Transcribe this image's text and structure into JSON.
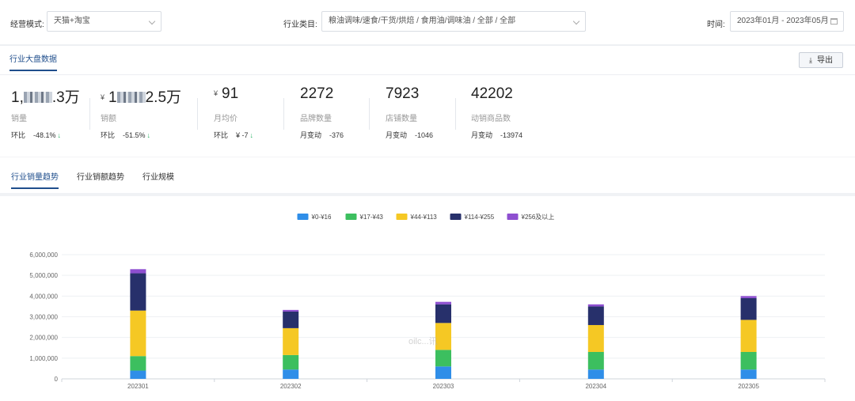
{
  "filters": {
    "mode_label": "经营模式:",
    "mode_value": "天猫+淘宝",
    "industry_label": "行业类目:",
    "industry_value": "粮油调味/速食/干货/烘焙 / 食用油/调味油 / 全部 / 全部",
    "time_label": "时间:",
    "time_value": "2023年01月 - 2023年05月"
  },
  "section": {
    "tab": "行业大盘数据",
    "export_label": "导出"
  },
  "metrics": [
    {
      "value_prefix": "1,",
      "value_suffix": ".3万",
      "currency": "",
      "label": "销量",
      "change_label": "环比",
      "change_value": "-48.1%",
      "arrow": "↓"
    },
    {
      "value_prefix": "1",
      "value_suffix": "2.5万",
      "currency": "¥",
      "label": "销额",
      "change_label": "环比",
      "change_value": "-51.5%",
      "arrow": "↓"
    },
    {
      "value": "91",
      "currency": "¥",
      "label": "月均价",
      "change_label": "环比",
      "change_value": "¥ -7",
      "arrow": "↓"
    },
    {
      "value": "2272",
      "label": "品牌数量",
      "change_label": "月变动",
      "change_value": "-376"
    },
    {
      "value": "7923",
      "label": "店铺数量",
      "change_label": "月变动",
      "change_value": "-1046"
    },
    {
      "value": "42202",
      "label": "动销商品数",
      "change_label": "月变动",
      "change_value": "-13974"
    }
  ],
  "chart_tabs": [
    {
      "label": "行业销量趋势",
      "active": true
    },
    {
      "label": "行业销额趋势",
      "active": false
    },
    {
      "label": "行业规模",
      "active": false
    }
  ],
  "chart_data": {
    "type": "bar",
    "stacked": true,
    "categories": [
      "202301",
      "202302",
      "202303",
      "202304",
      "202305"
    ],
    "series": [
      {
        "name": "¥0-¥16",
        "color": "#2f8ee8",
        "values": [
          400000,
          450000,
          600000,
          450000,
          450000
        ]
      },
      {
        "name": "¥17-¥43",
        "color": "#3cbf5f",
        "values": [
          700000,
          700000,
          800000,
          850000,
          850000
        ]
      },
      {
        "name": "¥44-¥113",
        "color": "#f5c824",
        "values": [
          2200000,
          1300000,
          1300000,
          1300000,
          1550000
        ]
      },
      {
        "name": "¥114-¥255",
        "color": "#27306b",
        "values": [
          1800000,
          800000,
          900000,
          900000,
          1050000
        ]
      },
      {
        "name": "¥256及以上",
        "color": "#8e4fd0",
        "values": [
          200000,
          80000,
          120000,
          100000,
          100000
        ]
      }
    ],
    "yticks": [
      "0",
      "1,000,000",
      "2,000,000",
      "3,000,000",
      "4,000,000",
      "5,000,000",
      "6,000,000"
    ],
    "ylim": [
      0,
      6000000
    ],
    "legend_position": "top-center",
    "grid": true
  },
  "watermark": "oilc...讯"
}
